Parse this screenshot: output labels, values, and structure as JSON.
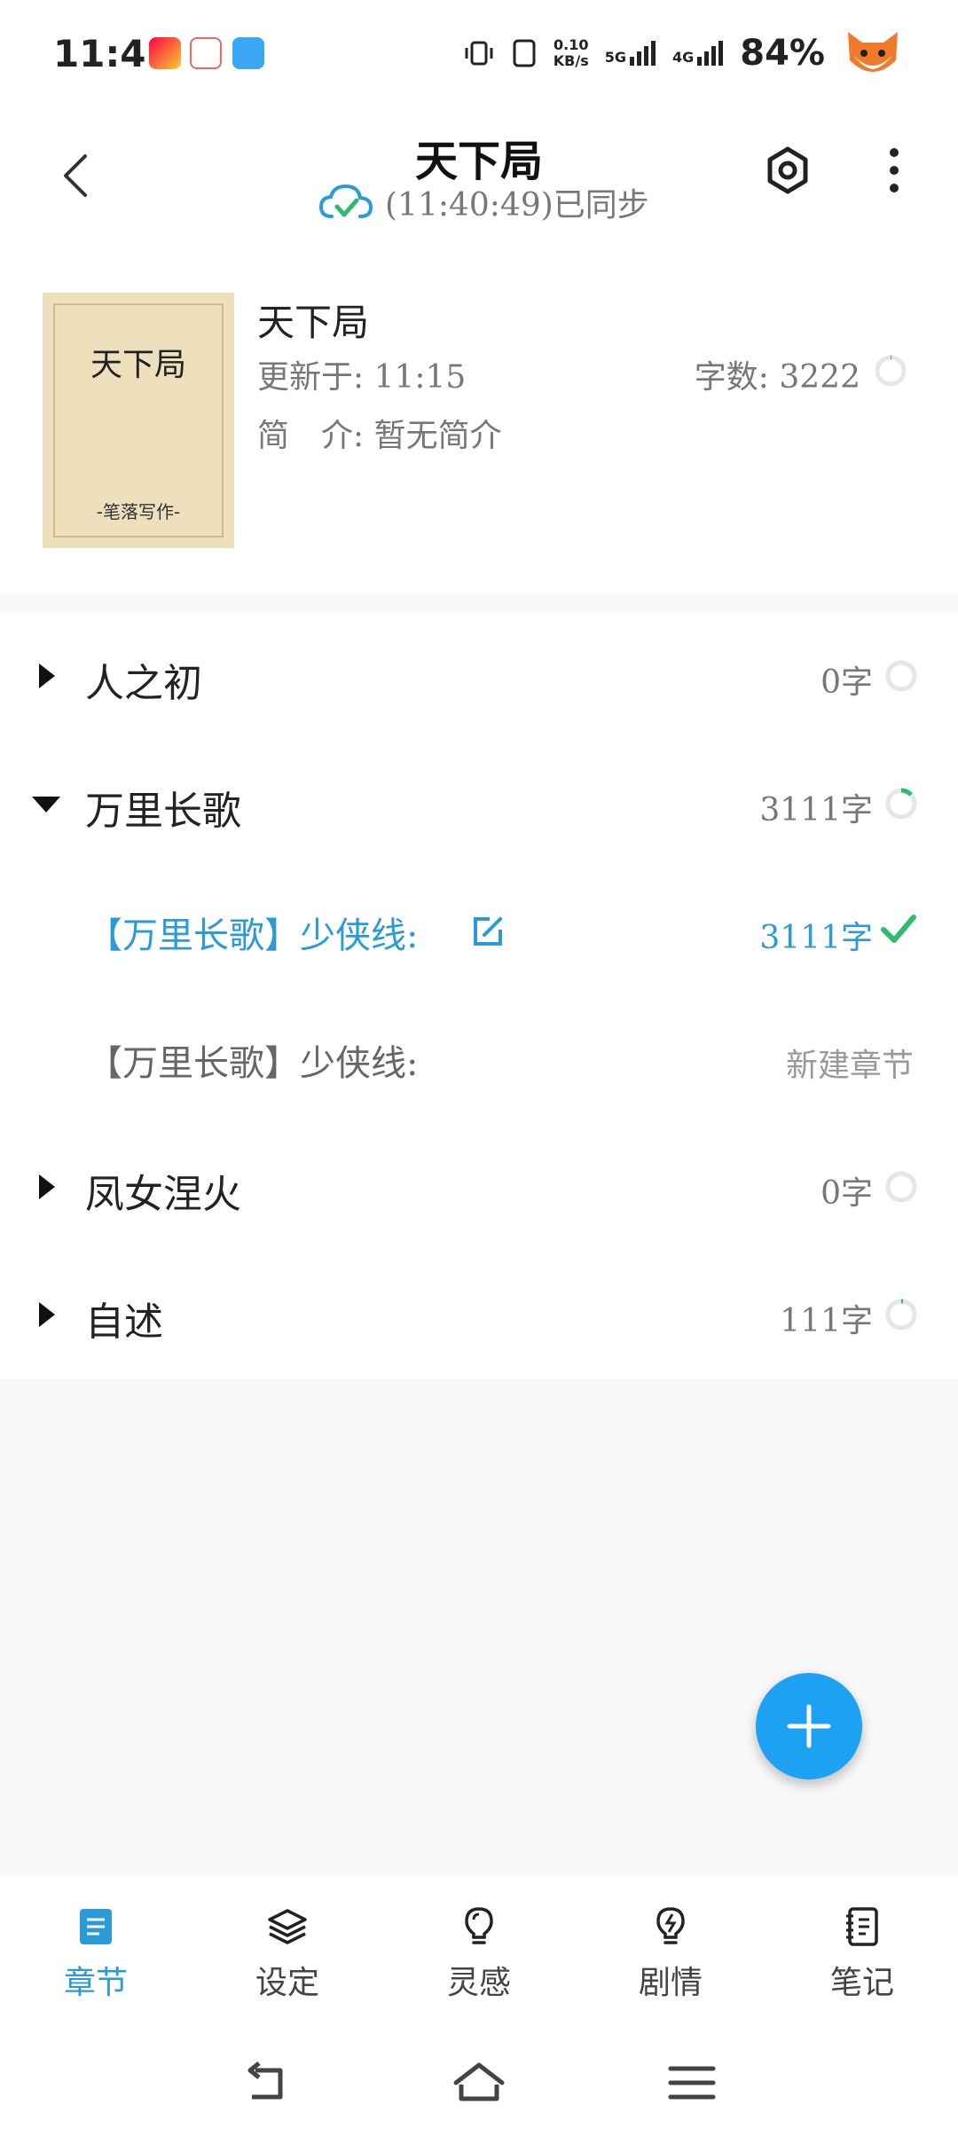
{
  "status_bar": {
    "time": "11:41",
    "network_speed_value": "0.10",
    "network_speed_unit": "KB/s",
    "sim1": "5G",
    "sim2": "4G",
    "battery": "84%"
  },
  "header": {
    "title": "天下局",
    "sync_status": "(11:40:49)已同步"
  },
  "book": {
    "cover_title": "天下局",
    "cover_subtitle": "-笔落写作-",
    "name": "天下局",
    "updated": "更新于: 11:15",
    "word_count": "字数: 3222",
    "intro": "简　介: 暂无简介"
  },
  "chapters": [
    {
      "title": "人之初",
      "count": "0字",
      "expanded": false
    },
    {
      "title": "万里长歌",
      "count": "3111字",
      "expanded": true
    },
    {
      "title": "【万里长歌】少侠线:",
      "count": "3111字",
      "active": true
    },
    {
      "title": "【万里长歌】少侠线:",
      "action": "新建章节"
    },
    {
      "title": "凤女涅火",
      "count": "0字",
      "expanded": false
    },
    {
      "title": "自述",
      "count": "111字",
      "expanded": false
    }
  ],
  "bottom_nav": [
    {
      "label": "章节",
      "icon": "document-icon",
      "active": true
    },
    {
      "label": "设定",
      "icon": "layers-icon"
    },
    {
      "label": "灵感",
      "icon": "lightbulb-icon"
    },
    {
      "label": "剧情",
      "icon": "bolt-bulb-icon"
    },
    {
      "label": "笔记",
      "icon": "notebook-icon"
    }
  ],
  "colors": {
    "accent": "#1da1f2",
    "link": "#2a9ad8",
    "success": "#2dbb6e",
    "cover": "#efe0bd"
  }
}
